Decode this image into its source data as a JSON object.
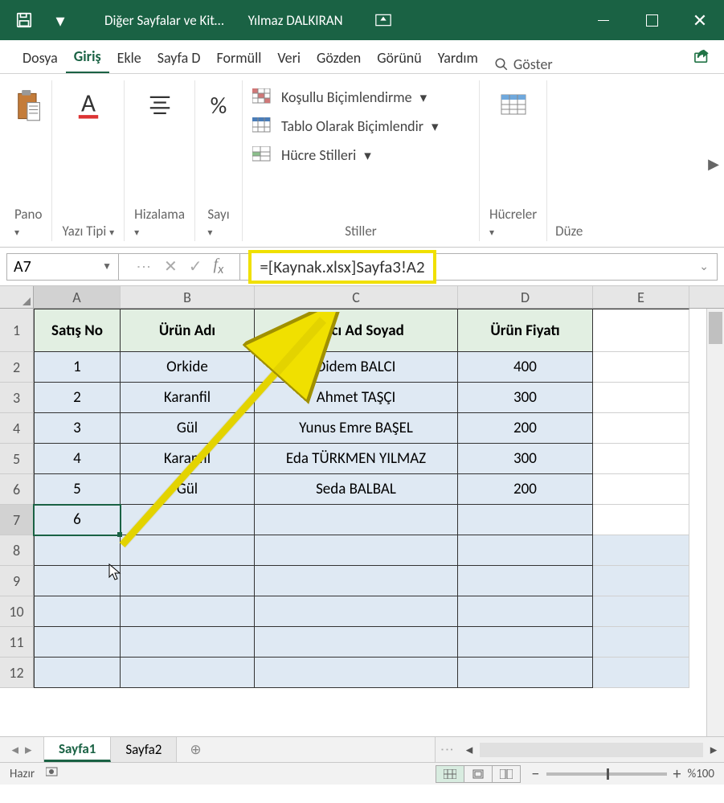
{
  "titlebar": {
    "doc": "Diğer Sayfalar ve Kit…",
    "user": "Yılmaz DALKIRAN"
  },
  "tabs": [
    "Dosya",
    "Giriş",
    "Ekle",
    "Sayfa D",
    "Formüll",
    "Veri",
    "Gözden",
    "Görünü",
    "Yardım"
  ],
  "tabs_active": 1,
  "tell": "Göster",
  "ribbon": {
    "pano": "Pano",
    "yazi": "Yazı Tipi",
    "hizalama": "Hizalama",
    "sayi": "Sayı",
    "kosullu": "Koşullu Biçimlendirme",
    "tablo": "Tablo Olarak Biçimlendir",
    "hucre_stil": "Hücre Stilleri",
    "stiller": "Stiller",
    "hucreler": "Hücreler",
    "duzen": "Düze"
  },
  "namebox": "A7",
  "formula": "=[Kaynak.xlsx]Sayfa3!A2",
  "columns": [
    "A",
    "B",
    "C",
    "D",
    "E"
  ],
  "rownums": [
    "1",
    "2",
    "3",
    "4",
    "5",
    "6",
    "7",
    "8",
    "9",
    "10",
    "11",
    "12"
  ],
  "headers": [
    "Satış No",
    "Ürün Adı",
    "Satıcı Ad Soyad",
    "Ürün Fiyatı"
  ],
  "rows": [
    [
      "1",
      "Orkide",
      "Didem BALCI",
      "400"
    ],
    [
      "2",
      "Karanfil",
      "Ahmet TAŞÇI",
      "300"
    ],
    [
      "3",
      "Gül",
      "Yunus Emre BAŞEL",
      "200"
    ],
    [
      "4",
      "Karanfil",
      "Eda TÜRKMEN YILMAZ",
      "300"
    ],
    [
      "5",
      "Gül",
      "Seda BALBAL",
      "200"
    ],
    [
      "6",
      "",
      "",
      ""
    ]
  ],
  "sheets": [
    "Sayfa1",
    "Sayfa2"
  ],
  "sheet_active": 0,
  "status": {
    "ready": "Hazır",
    "zoom": "%100"
  }
}
